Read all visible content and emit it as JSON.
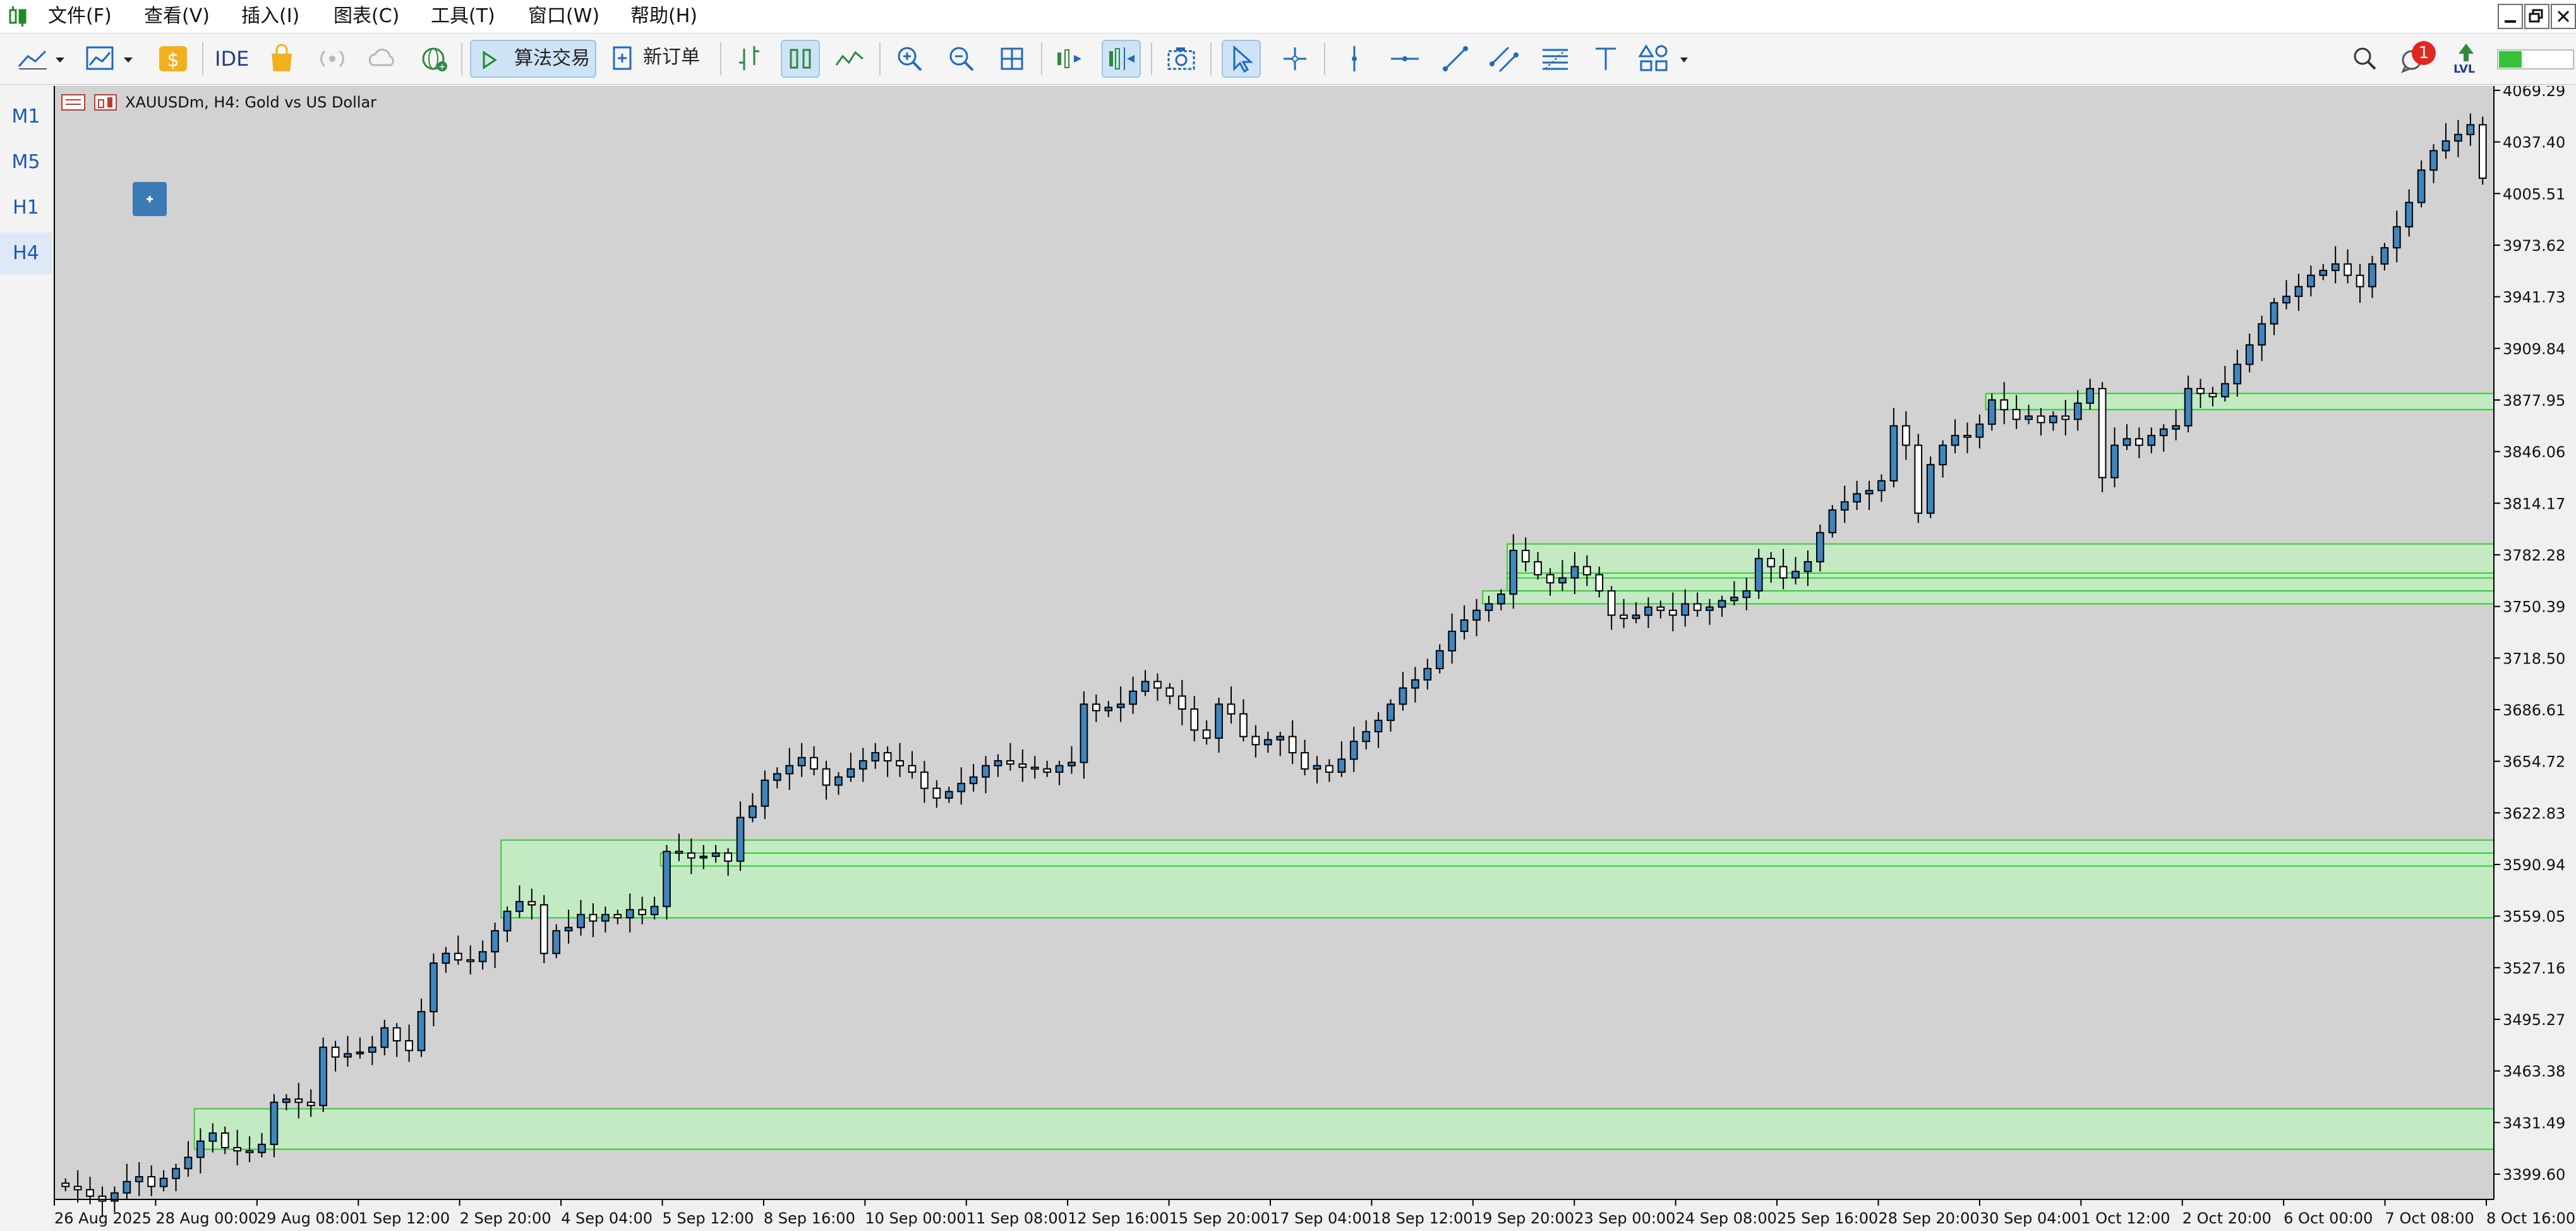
{
  "menu": {
    "items": [
      "文件(F)",
      "查看(V)",
      "插入(I)",
      "图表(C)",
      "工具(T)",
      "窗口(W)",
      "帮助(H)"
    ]
  },
  "toolbar": {
    "ide_label": "IDE",
    "algo_trading_label": "算法交易",
    "new_order_label": "新订单",
    "notification_count": "1",
    "lvl_label": "LVL"
  },
  "timeframes": [
    "M1",
    "M5",
    "H1",
    "H4"
  ],
  "active_timeframe": "H4",
  "chart_title": "XAUUSDm, H4:  Gold vs US Dollar",
  "colors": {
    "chart_bg": "#d2d2d2",
    "bull_candle": "#3e86c0",
    "bear_candle": "#ffffff",
    "zone_fill": "#c2efc2",
    "zone_border": "#38c938",
    "timeframe_text": "#1a56b8"
  },
  "chart_data": {
    "type": "candlestick",
    "symbol": "XAUUSDm",
    "timeframe": "H4",
    "y_ticks": [
      4069.29,
      4037.4,
      4005.51,
      3973.62,
      3941.73,
      3909.84,
      3877.95,
      3846.06,
      3814.17,
      3782.28,
      3750.39,
      3718.5,
      3686.61,
      3654.72,
      3622.83,
      3590.94,
      3559.05,
      3527.16,
      3495.27,
      3463.38,
      3431.49,
      3399.6
    ],
    "x_ticks": [
      "26 Aug 2025",
      "28 Aug 00:00",
      "29 Aug 08:00",
      "1 Sep 12:00",
      "2 Sep 20:00",
      "4 Sep 04:00",
      "5 Sep 12:00",
      "8 Sep 16:00",
      "10 Sep 00:00",
      "11 Sep 08:00",
      "12 Sep 16:00",
      "15 Sep 20:00",
      "17 Sep 04:00",
      "18 Sep 12:00",
      "19 Sep 20:00",
      "23 Sep 00:00",
      "24 Sep 08:00",
      "25 Sep 16:00",
      "28 Sep 20:00",
      "30 Sep 04:00",
      "1 Oct 12:00",
      "2 Oct 20:00",
      "6 Oct 00:00",
      "7 Oct 08:00",
      "8 Oct 16:00"
    ],
    "ylim": [
      3384,
      4072
    ],
    "close_series": [
      3392,
      3390,
      3386,
      3383,
      3388,
      3395,
      3398,
      3392,
      3397,
      3403,
      3410,
      3420,
      3425,
      3416,
      3414,
      3413,
      3418,
      3444,
      3446,
      3444,
      3442,
      3478,
      3472,
      3474,
      3475,
      3478,
      3490,
      3482,
      3476,
      3500,
      3530,
      3536,
      3532,
      3531,
      3537,
      3550,
      3562,
      3568,
      3566,
      3536,
      3550,
      3552,
      3560,
      3556,
      3560,
      3558,
      3563,
      3560,
      3565,
      3599,
      3598,
      3595,
      3596,
      3598,
      3593,
      3620,
      3627,
      3643,
      3647,
      3652,
      3657,
      3650,
      3640,
      3645,
      3650,
      3655,
      3660,
      3655,
      3652,
      3648,
      3638,
      3632,
      3636,
      3641,
      3645,
      3652,
      3655,
      3653,
      3651,
      3650,
      3648,
      3652,
      3654,
      3690,
      3686,
      3688,
      3690,
      3698,
      3704,
      3700,
      3695,
      3687,
      3674,
      3669,
      3690,
      3684,
      3670,
      3665,
      3668,
      3670,
      3660,
      3650,
      3652,
      3648,
      3656,
      3667,
      3673,
      3680,
      3690,
      3700,
      3705,
      3712,
      3723,
      3735,
      3742,
      3748,
      3752,
      3758,
      3785,
      3778,
      3770,
      3765,
      3768,
      3775,
      3770,
      3760,
      3745,
      3743,
      3745,
      3750,
      3748,
      3745,
      3752,
      3748,
      3750,
      3754,
      3756,
      3760,
      3780,
      3775,
      3768,
      3772,
      3778,
      3796,
      3810,
      3815,
      3820,
      3822,
      3828,
      3862,
      3850,
      3808,
      3838,
      3850,
      3856,
      3855,
      3863,
      3878,
      3872,
      3866,
      3868,
      3864,
      3868,
      3866,
      3876,
      3885,
      3830,
      3850,
      3854,
      3850,
      3856,
      3860,
      3862,
      3885,
      3882,
      3880,
      3888,
      3900,
      3912,
      3925,
      3938,
      3942,
      3948,
      3955,
      3958,
      3962,
      3955,
      3948,
      3962,
      3972,
      3985,
      4000,
      4020,
      4032,
      4038,
      4042,
      4048,
      4015
    ],
    "support_zones": [
      {
        "top": 3440,
        "bottom": 3415
      },
      {
        "top": 3606,
        "bottom": 3558
      },
      {
        "top": 3598,
        "bottom": 3590
      },
      {
        "top": 3789,
        "bottom": 3760
      },
      {
        "top": 3771,
        "bottom": 3768
      },
      {
        "top": 3760,
        "bottom": 3752
      },
      {
        "top": 3882,
        "bottom": 3872
      }
    ]
  }
}
